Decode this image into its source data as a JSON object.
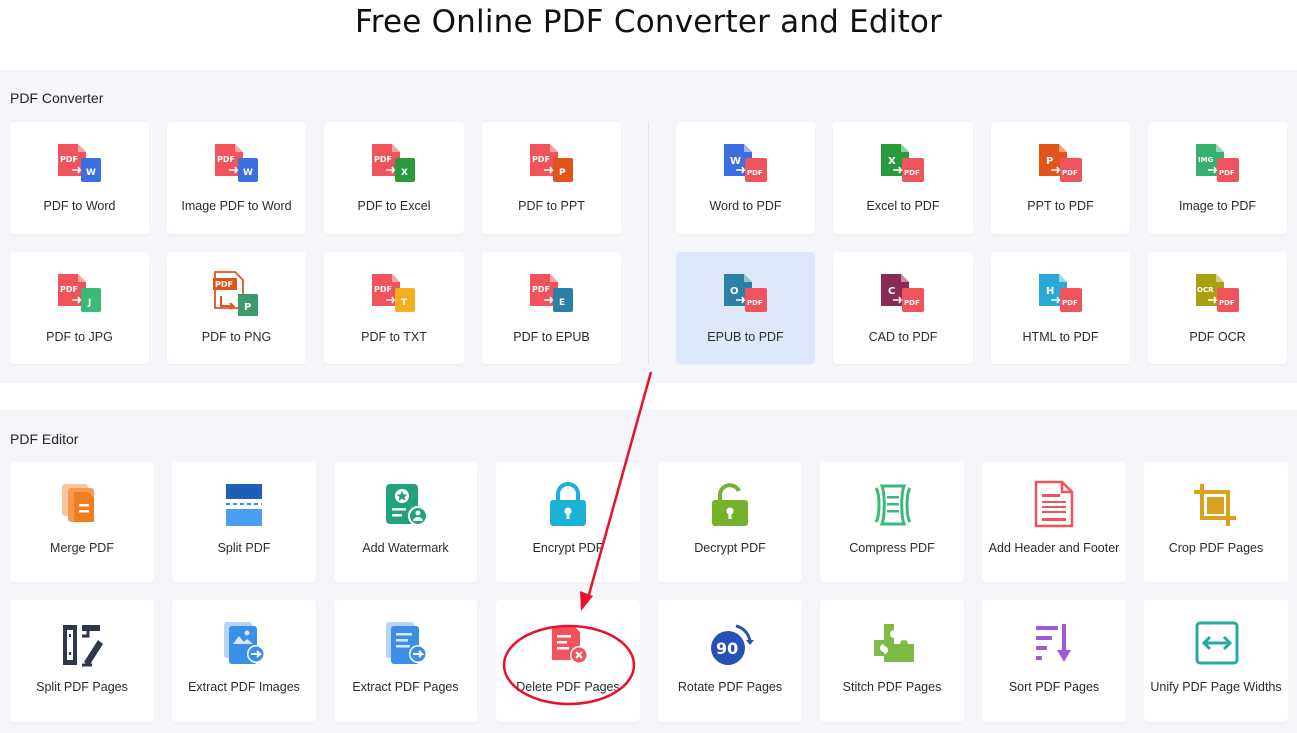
{
  "page": {
    "title": "Free Online PDF Converter and Editor"
  },
  "converter": {
    "title": "PDF Converter",
    "left": [
      {
        "label": "PDF to Word",
        "icon": "pdf-to-word-icon"
      },
      {
        "label": "Image PDF to Word",
        "icon": "image-pdf-to-word-icon"
      },
      {
        "label": "PDF to Excel",
        "icon": "pdf-to-excel-icon"
      },
      {
        "label": "PDF to PPT",
        "icon": "pdf-to-ppt-icon"
      },
      {
        "label": "PDF to JPG",
        "icon": "pdf-to-jpg-icon"
      },
      {
        "label": "PDF to PNG",
        "icon": "pdf-to-png-icon"
      },
      {
        "label": "PDF to TXT",
        "icon": "pdf-to-txt-icon"
      },
      {
        "label": "PDF to EPUB",
        "icon": "pdf-to-epub-icon"
      }
    ],
    "right": [
      {
        "label": "Word to PDF",
        "icon": "word-to-pdf-icon"
      },
      {
        "label": "Excel to PDF",
        "icon": "excel-to-pdf-icon"
      },
      {
        "label": "PPT to PDF",
        "icon": "ppt-to-pdf-icon"
      },
      {
        "label": "Image to PDF",
        "icon": "image-to-pdf-icon"
      },
      {
        "label": "EPUB to PDF",
        "icon": "epub-to-pdf-icon",
        "active": true
      },
      {
        "label": "CAD to PDF",
        "icon": "cad-to-pdf-icon"
      },
      {
        "label": "HTML to PDF",
        "icon": "html-to-pdf-icon"
      },
      {
        "label": "PDF OCR",
        "icon": "pdf-ocr-icon"
      }
    ],
    "glyphs": {
      "pdf": "PDF",
      "word": "W",
      "excel": "X",
      "ppt": "P",
      "jpg": "J",
      "png": "P",
      "txt": "T",
      "epub": "E",
      "epub_src": "O",
      "cad": "C",
      "html": "H",
      "img": "IMG",
      "ocr": "OCR"
    }
  },
  "editor": {
    "title": "PDF Editor",
    "items": [
      {
        "label": "Merge PDF",
        "icon": "merge-pdf-icon"
      },
      {
        "label": "Split PDF",
        "icon": "split-pdf-icon"
      },
      {
        "label": "Add Watermark",
        "icon": "add-watermark-icon"
      },
      {
        "label": "Encrypt PDF",
        "icon": "encrypt-pdf-icon"
      },
      {
        "label": "Decrypt PDF",
        "icon": "decrypt-pdf-icon"
      },
      {
        "label": "Compress PDF",
        "icon": "compress-pdf-icon"
      },
      {
        "label": "Add Header and Footer",
        "icon": "add-header-footer-icon"
      },
      {
        "label": "Crop PDF Pages",
        "icon": "crop-pdf-pages-icon"
      },
      {
        "label": "Split PDF Pages",
        "icon": "split-pdf-pages-icon"
      },
      {
        "label": "Extract PDF Images",
        "icon": "extract-pdf-images-icon"
      },
      {
        "label": "Extract PDF Pages",
        "icon": "extract-pdf-pages-icon"
      },
      {
        "label": "Delete PDF Pages",
        "icon": "delete-pdf-pages-icon"
      },
      {
        "label": "Rotate PDF Pages",
        "icon": "rotate-pdf-pages-icon"
      },
      {
        "label": "Stitch PDF Pages",
        "icon": "stitch-pdf-pages-icon"
      },
      {
        "label": "Sort PDF Pages",
        "icon": "sort-pdf-pages-icon"
      },
      {
        "label": "Unify PDF Page Widths",
        "icon": "unify-pdf-page-widths-icon"
      }
    ],
    "rotate_glyph": "90"
  },
  "colors": {
    "pdf_red": "#f0535b",
    "word_blue": "#3b6fe0",
    "excel_green": "#2a9b3c",
    "ppt_orange": "#e2541b",
    "jpg_green": "#3cb878",
    "txt_yellow": "#f2b01e",
    "epub_teal": "#2c7fa7",
    "img_green": "#35b16d",
    "cad_purple": "#8c2a55",
    "html_cyan": "#29a9d8",
    "ocr_olive": "#a8a012",
    "annotation_red": "#e8102a"
  }
}
